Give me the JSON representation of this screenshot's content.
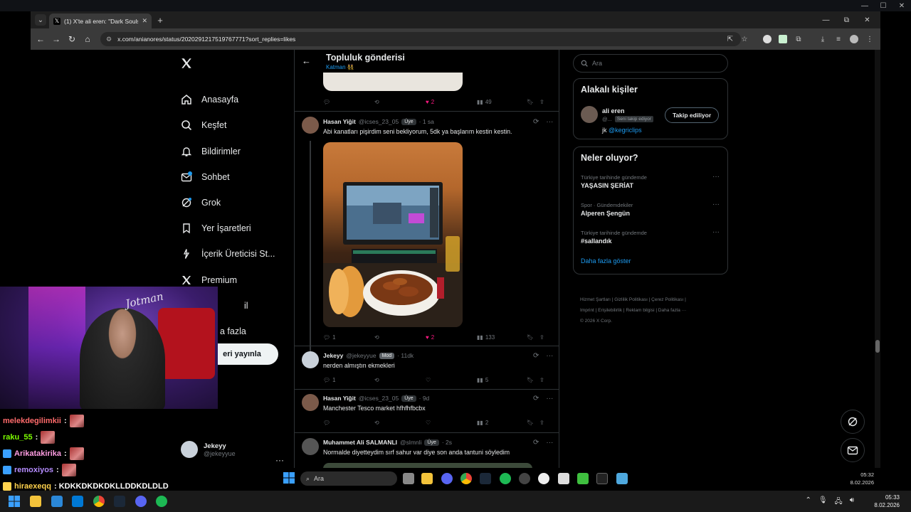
{
  "desktop": {
    "controls": [
      "—",
      "☐",
      "✕"
    ]
  },
  "browser": {
    "tab_title": "(1) X'te ali eren: \"Dark Souls 3",
    "tab_close": "✕",
    "new_tab": "+",
    "url": "x.com/anianores/status/2020291217519767771?sort_replies=likes",
    "win_controls": [
      "—",
      "⧉",
      "✕"
    ]
  },
  "nav": {
    "items": [
      {
        "label": "Anasayfa"
      },
      {
        "label": "Keşfet"
      },
      {
        "label": "Bildirimler"
      },
      {
        "label": "Sohbet"
      },
      {
        "label": "Grok"
      },
      {
        "label": "Yer İşaretleri"
      },
      {
        "label": "İçerik Üreticisi St..."
      },
      {
        "label": "Premium"
      },
      {
        "label": "il"
      },
      {
        "label": "a fazla"
      }
    ],
    "post_button": "eri yayınla",
    "account_name": "Jekeyy",
    "account_handle": "@jekeyyue",
    "account_more": "···"
  },
  "main": {
    "header_title": "Topluluk gönderisi",
    "header_sub": "Katman 👯",
    "top_actions": {
      "likes": "2",
      "views": "49"
    },
    "posts": [
      {
        "name": "Hasan Yiğit",
        "handle": "@icses_23_05",
        "badge": "Üye",
        "time": "· 1 sa",
        "text": "Abi kanatları pişirdim seni bekliyorum, 5dk ya başlarım kestin kestin.",
        "replies": "1",
        "likes": "2",
        "views": "133"
      },
      {
        "name": "Jekeyy",
        "handle": "@jekeyyue",
        "badge": "Mod",
        "time": "· 11dk",
        "text": "nerden almıştın ekmekleri",
        "replies": "1",
        "likes": "",
        "views": "5"
      },
      {
        "name": "Hasan Yiğit",
        "handle": "@icses_23_05",
        "badge": "Üye",
        "time": "· 9d",
        "text": "Manchester Tesco market  hfhfhfbcbx",
        "replies": "",
        "likes": "",
        "views": "2"
      },
      {
        "name": "Muhammet Ali SALMANLI",
        "handle": "@slmnli",
        "badge": "Üye",
        "time": "· 2s",
        "text": "Normalde diyetteydim sırf sahur var diye son anda tantuni söyledim"
      }
    ]
  },
  "sidebar": {
    "search_placeholder": "Ara",
    "related_title": "Alakalı kişiler",
    "related_name": "ali eren",
    "related_handle": "@...",
    "related_follows_you": "Seni takip ediyor",
    "related_bio_prefix": "jk",
    "related_bio_link": "@kegriclips",
    "follow_button": "Takip ediliyor",
    "trends_title": "Neler oluyor?",
    "trends": [
      {
        "context": "Türkiye tarihinde gündemde",
        "name": "YAŞASIN ŞERİAT"
      },
      {
        "context": "Spor · Gündemdekiler",
        "name": "Alperen Şengün"
      },
      {
        "context": "Türkiye tarihinde gündemde",
        "name": "#sallandık"
      }
    ],
    "trend_more": "···",
    "show_more": "Daha fazla göster",
    "footer_line1": "Hizmet Şartları  |  Gizlilik Politikası  |  Çerez Politikası  |",
    "footer_line2": "Imprint  |  Erişilebilirlik  |  Reklam bilgisi  |  Daha fazla ···",
    "footer_line3": "© 2026 X Corp."
  },
  "webcam": {
    "sign": "Jotman"
  },
  "chat": [
    {
      "user": "melekdegilimkii",
      "color": "#ff6b6b",
      "msg": ":",
      "emote": true,
      "badge": false
    },
    {
      "user": "raku_55",
      "color": "#7CFC00",
      "msg": ":",
      "emote": true,
      "badge": false
    },
    {
      "user": "Arikatakirika",
      "color": "#ff9de2",
      "msg": ":",
      "emote": true,
      "badge": true
    },
    {
      "user": "remoxiyos",
      "color": "#b58cff",
      "msg": ":",
      "emote": true,
      "badge": true
    },
    {
      "user": "hiraexeqq",
      "color": "#ffd24d",
      "msg": ": KDKKDKDKDKLLDDKDLDLD",
      "emote": false,
      "badge": true
    }
  ],
  "inner_taskbar": {
    "search": "Ara",
    "time": "05:32",
    "date": "8.02.2026"
  },
  "outer_taskbar": {
    "time": "05:33",
    "date": "8.02.2026"
  },
  "colors": {
    "accent": "#1d9bf0",
    "like": "#f91880",
    "border": "#2f3336",
    "muted": "#71767b"
  }
}
